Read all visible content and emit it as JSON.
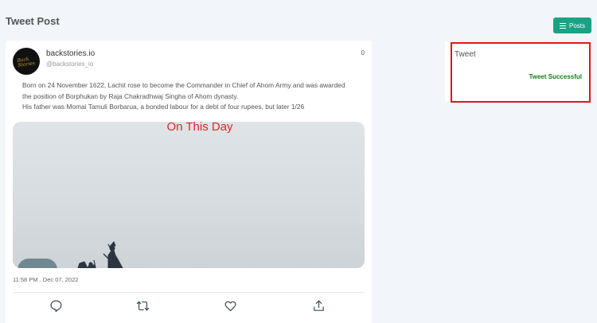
{
  "header": {
    "title": "Tweet Post",
    "posts_button_label": "Posts"
  },
  "tweet": {
    "display_name": "backstories.io",
    "handle": "@backstories_io",
    "avatar_text": "Back Stories",
    "count": "0",
    "lines": [
      "Born on 24 November 1622, Lachit rose to become the Commander in Chief of Ahom Army and was awarded",
      "the position of Borphukan by Raja Chakradhwaj Singha of Ahom dynasty.",
      "His father was Momai Tamuli Borbarua, a bonded labour for a debt of four rupees, but later 1/26"
    ],
    "media_caption": "On This Day",
    "timestamp": "11:58 PM . Dec 07, 2022",
    "actions": [
      "comment-icon",
      "retweet-icon",
      "like-icon",
      "share-icon"
    ]
  },
  "status": {
    "title": "Tweet",
    "message": "Tweet Successful",
    "message_color": "#14801d",
    "highlight_color": "#e0151b"
  },
  "colors": {
    "accent": "#1aa285",
    "caption": "#d42a2a"
  }
}
